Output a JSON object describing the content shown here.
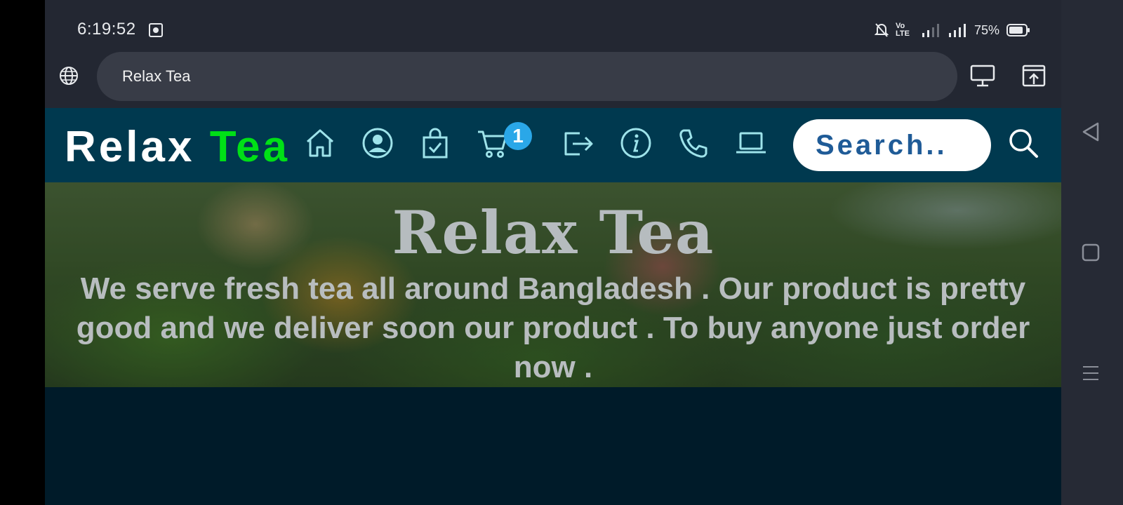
{
  "status_bar": {
    "time": "6:19:52",
    "network": "Vo LTE",
    "battery": "75%"
  },
  "browser": {
    "url_text": "Relax Tea"
  },
  "site": {
    "logo_part1": "Relax",
    "logo_part2": "Tea",
    "cart_count": "1",
    "search_placeholder": "Search..",
    "nav_icons": [
      "home-icon",
      "user-icon",
      "shopping-bag-icon",
      "cart-icon",
      "logout-icon",
      "info-icon",
      "phone-icon",
      "laptop-icon"
    ],
    "colors": {
      "navbar": "#00394f",
      "logo_accent": "#00e016",
      "badge": "#2aa7e8",
      "page_bg": "#001b29"
    }
  },
  "hero": {
    "title": "Relax Tea",
    "text": "We serve fresh tea all around Bangladesh . Our product is pretty good and we deliver soon our product . To buy anyone just order now ."
  }
}
